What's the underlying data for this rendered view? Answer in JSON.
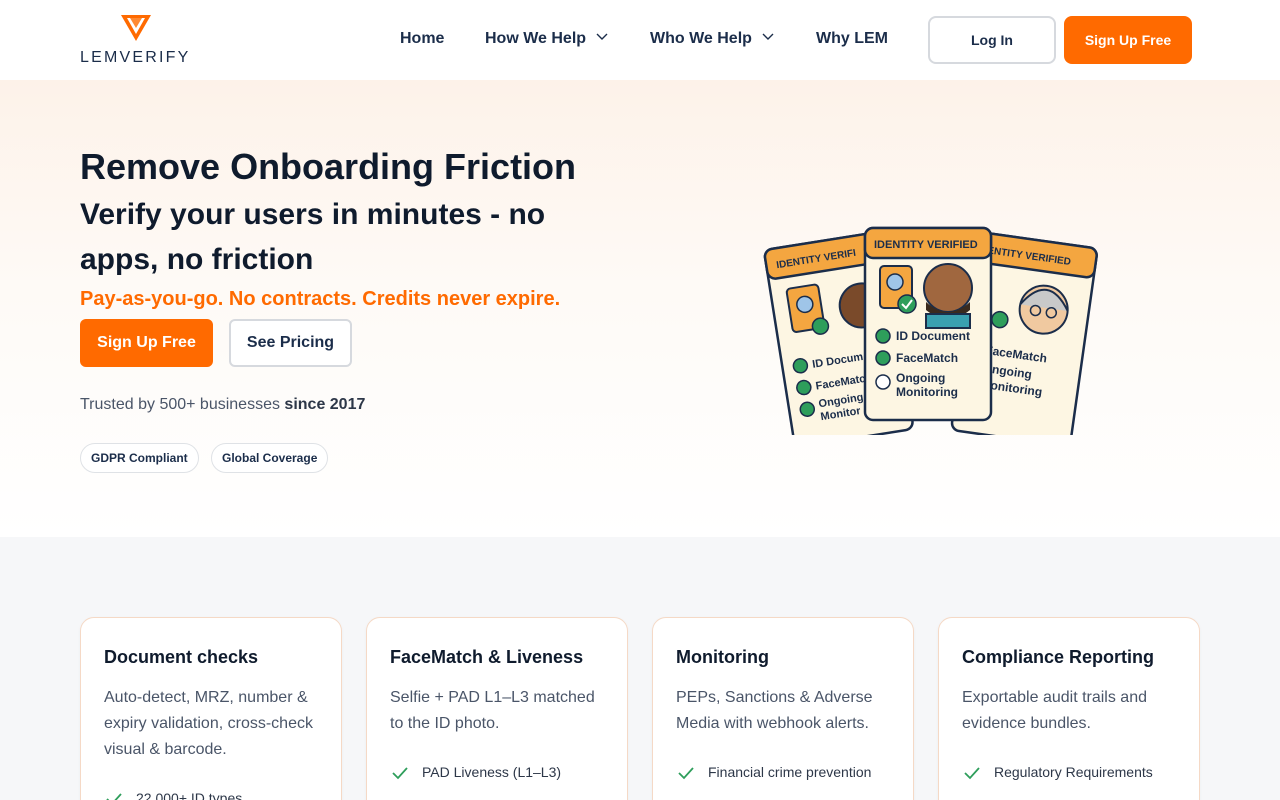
{
  "brand": {
    "name_part1": "LEM",
    "name_part2": "VERIFY",
    "accent": "#ff6a00",
    "dark": "#0f1b2d"
  },
  "nav": {
    "items": [
      {
        "label": "Home",
        "has_dropdown": false
      },
      {
        "label": "How We Help",
        "has_dropdown": true
      },
      {
        "label": "Who We Help",
        "has_dropdown": true
      },
      {
        "label": "Why LEM",
        "has_dropdown": false
      }
    ],
    "login_label": "Log In",
    "signup_label": "Sign Up Free"
  },
  "hero": {
    "title": "Remove Onboarding Friction",
    "subtitle": "Verify your users in minutes - no apps, no friction",
    "tagline": "Pay-as-you-go. No contracts. Credits never expire.",
    "primary_cta": "Sign Up Free",
    "secondary_cta": "See Pricing",
    "trusted_prefix": "Trusted by 500+ businesses ",
    "trusted_bold": "since 2017",
    "badges": [
      "GDPR Compliant",
      "Global Coverage"
    ],
    "illustration": {
      "card_header": "IDENTITY VERIFIED",
      "left_card_header": "IDENTITY VERIFI",
      "right_card_header": "ENTITY VERIFIED",
      "checks": [
        "ID Document",
        "FaceMatch",
        "Ongoing",
        "Monitoring"
      ],
      "left_checks": [
        "ID Docum",
        "FaceMatc",
        "Ongoing",
        "Monitor"
      ],
      "right_checks": [
        "FaceMatch",
        "Ongoing",
        "Monitoring"
      ]
    }
  },
  "features": [
    {
      "title": "Document checks",
      "desc": "Auto-detect, MRZ, number & expiry validation, cross-check visual & barcode.",
      "items": [
        "22,000+ ID types"
      ]
    },
    {
      "title": "FaceMatch & Liveness",
      "desc": "Selfie + PAD L1–L3 matched to the ID photo.",
      "items": [
        "PAD Liveness (L1–L3)"
      ]
    },
    {
      "title": "Monitoring",
      "desc": "PEPs, Sanctions & Adverse Media with webhook alerts.",
      "items": [
        "Financial crime prevention"
      ]
    },
    {
      "title": "Compliance Reporting",
      "desc": "Exportable audit trails and evidence bundles.",
      "items": [
        "Regulatory Requirements"
      ]
    }
  ]
}
